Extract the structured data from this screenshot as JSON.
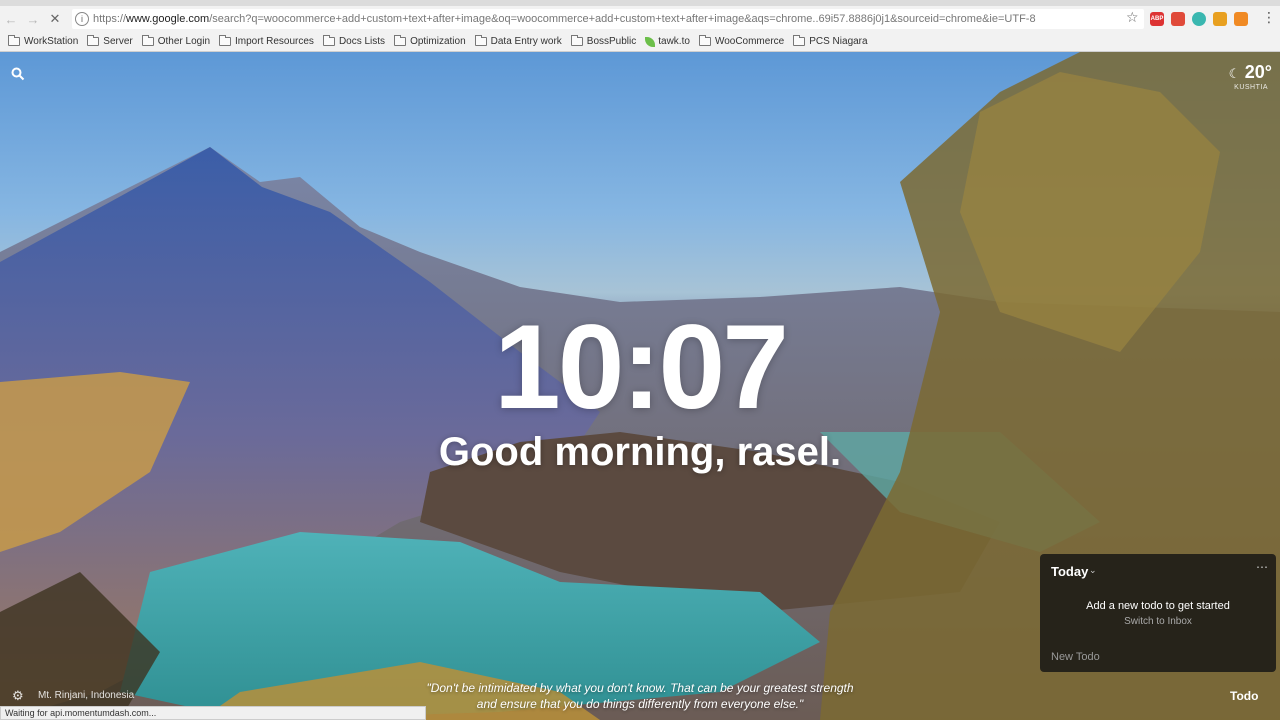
{
  "browser": {
    "url_scheme": "https://",
    "url_host": "www.google.com",
    "url_rest": "/search?q=woocommerce+add+custom+text+after+image&oq=woocommerce+add+custom+text+after+image&aqs=chrome..69i57.8886j0j1&sourceid=chrome&ie=UTF-8",
    "status_text": "Waiting for api.momentumdash.com...",
    "extensions": [
      {
        "name": "adblock-icon",
        "label": "ABP",
        "color": "#d33"
      },
      {
        "name": "extension-red-icon",
        "label": "",
        "color": "#e04a3a"
      },
      {
        "name": "extension-teal-icon",
        "label": "",
        "color": "#3ab7b0"
      },
      {
        "name": "extension-chrome-icon",
        "label": "",
        "color": "#e8a020"
      },
      {
        "name": "extension-orange-icon",
        "label": "",
        "color": "#f08a24"
      }
    ]
  },
  "bookmarks": [
    {
      "type": "folder",
      "label": "WorkStation"
    },
    {
      "type": "folder",
      "label": "Server"
    },
    {
      "type": "folder",
      "label": "Other Login"
    },
    {
      "type": "folder",
      "label": "Import Resources"
    },
    {
      "type": "folder",
      "label": "Docs Lists"
    },
    {
      "type": "folder",
      "label": "Optimization"
    },
    {
      "type": "folder",
      "label": "Data Entry work"
    },
    {
      "type": "folder",
      "label": "BossPublic"
    },
    {
      "type": "site",
      "label": "tawk.to"
    },
    {
      "type": "folder",
      "label": "WooCommerce"
    },
    {
      "type": "folder",
      "label": "PCS Niagara"
    }
  ],
  "momentum": {
    "weather_temp": "20°",
    "weather_city": "KUSHTIA",
    "clock": "10:07",
    "greeting": "Good morning, rasel.",
    "location": "Mt. Rinjani, Indonesia",
    "quote_line1": "\"Don't be intimidated by what you don't know. That can be your greatest strength",
    "quote_line2": "and ensure that you do things differently from everyone else.\"",
    "todo_link": "Todo"
  },
  "todo_panel": {
    "title": "Today",
    "empty_message": "Add a new todo to get started",
    "switch_label": "Switch to Inbox",
    "new_placeholder": "New Todo"
  }
}
